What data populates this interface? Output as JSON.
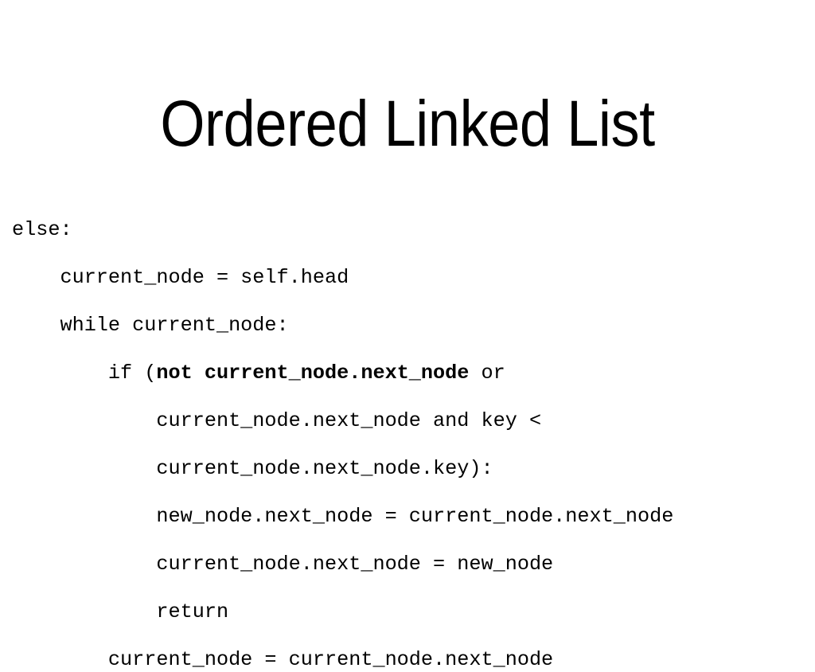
{
  "slide": {
    "background_color": "#ffffff",
    "text_color": "#000000",
    "title": "Ordered Linked List"
  },
  "code": {
    "language": "python",
    "lines": [
      {
        "indent": 0,
        "text": "else:"
      },
      {
        "indent": 4,
        "text": "current_node = self.head"
      },
      {
        "indent": 4,
        "text": "while current_node:"
      },
      {
        "indent": 8,
        "pre": "if (",
        "bold": "not current_node.next_node",
        "post": " or"
      },
      {
        "indent": 12,
        "text": "current_node.next_node and key <"
      },
      {
        "indent": 12,
        "text": "current_node.next_node.key):"
      },
      {
        "indent": 12,
        "text": "new_node.next_node = current_node.next_node"
      },
      {
        "indent": 12,
        "text": "current_node.next_node = new_node"
      },
      {
        "indent": 12,
        "text": "return"
      },
      {
        "indent": 8,
        "text": "current_node = current_node.next_node"
      }
    ],
    "full_text": "else:\n    current_node = self.head\n    while current_node:\n        if (not current_node.next_node or\n            current_node.next_node and key <\n            current_node.next_node.key):\n            new_node.next_node = current_node.next_node\n            current_node.next_node = new_node\n            return\n        current_node = current_node.next_node"
  }
}
